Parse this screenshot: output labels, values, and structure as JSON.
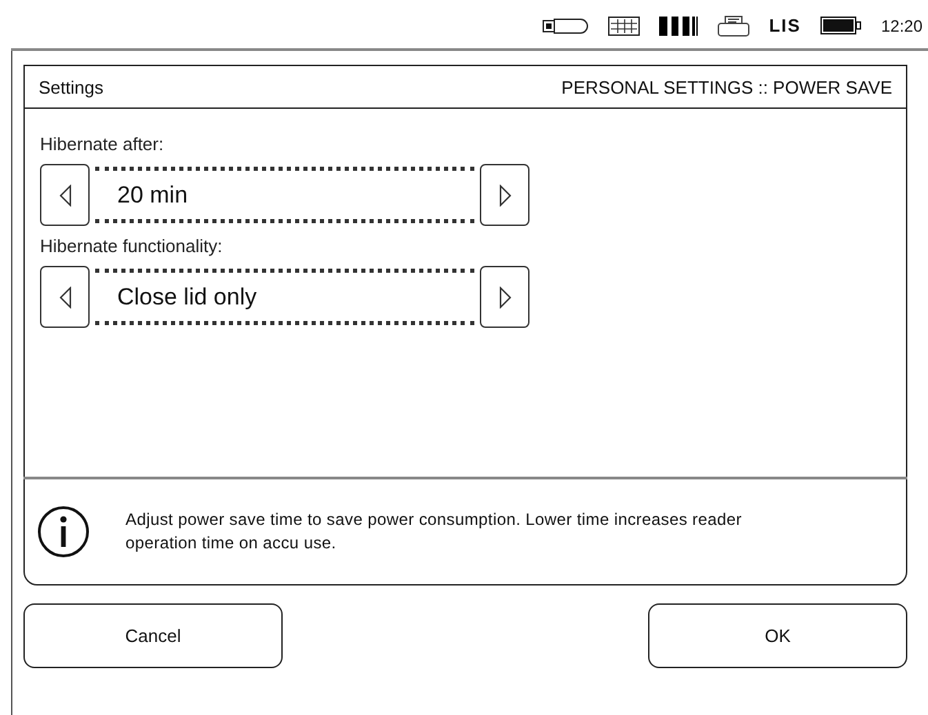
{
  "status_bar": {
    "lis_label": "LIS",
    "time": "12:20"
  },
  "panel": {
    "title": "Settings",
    "breadcrumb": "PERSONAL SETTINGS :: POWER SAVE"
  },
  "selectors": [
    {
      "label": "Hibernate after:",
      "value": "20 min"
    },
    {
      "label": "Hibernate functionality:",
      "value": "Close lid only"
    }
  ],
  "info": {
    "text": "Adjust power save time to save power consumption. Lower time increases reader operation time on accu use."
  },
  "buttons": [
    {
      "label": "Cancel"
    },
    {
      "label": "OK"
    }
  ]
}
